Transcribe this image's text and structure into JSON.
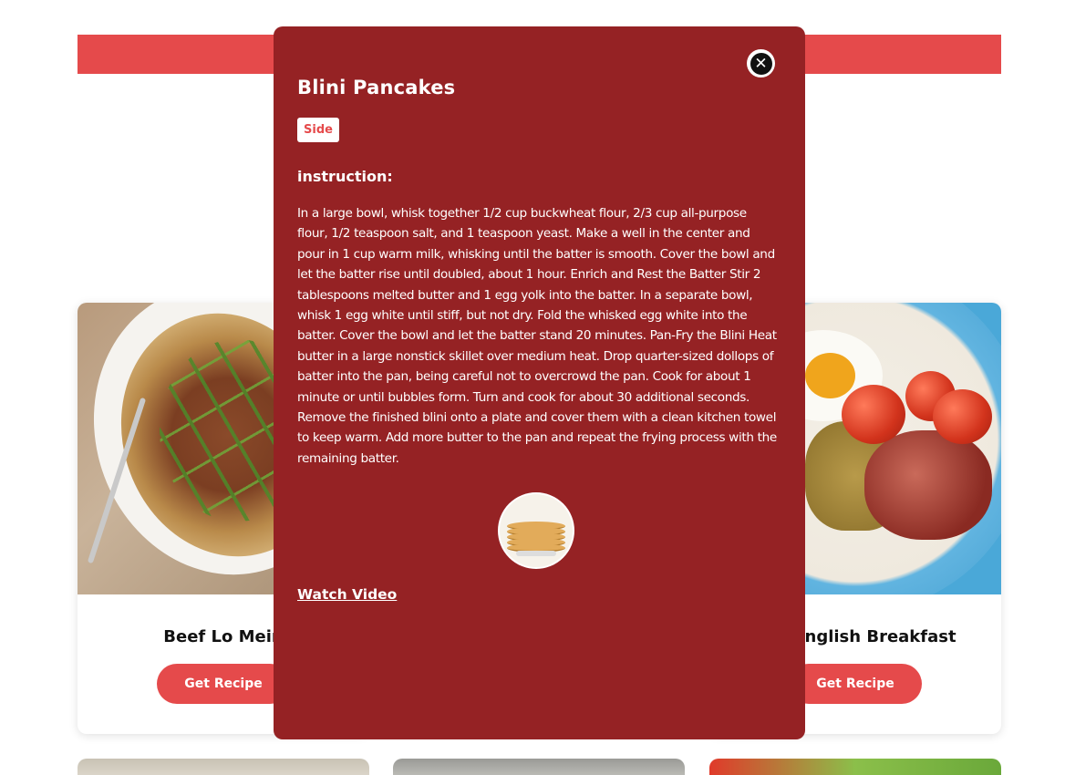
{
  "cards": [
    {
      "title": "Beef Lo Mein",
      "button": "Get Recipe"
    },
    {
      "title": "Full English Breakfast",
      "button": "Get Recipe"
    }
  ],
  "modal": {
    "title": "Blini Pancakes",
    "category": "Side",
    "instruction_label": "instruction:",
    "instructions": "In a large bowl, whisk together 1/2 cup buckwheat flour, 2/3 cup all-purpose flour, 1/2 teaspoon salt, and 1 teaspoon yeast. Make a well in the center and pour in 1 cup warm milk, whisking until the batter is smooth. Cover the bowl and let the batter rise until doubled, about 1 hour. Enrich and Rest the Batter Stir 2 tablespoons melted butter and 1 egg yolk into the batter. In a separate bowl, whisk 1 egg white until stiff, but not dry. Fold the whisked egg white into the batter. Cover the bowl and let the batter stand 20 minutes. Pan-Fry the Blini Heat butter in a large nonstick skillet over medium heat. Drop quarter-sized dollops of batter into the pan, being careful not to overcrowd the pan. Cook for about 1 minute or until bubbles form. Turn and cook for about 30 additional seconds. Remove the finished blini onto a plate and cover them with a clean kitchen towel to keep warm. Add more butter to the pan and repeat the frying process with the remaining batter.",
    "video_link": "Watch Video",
    "close_icon": "close-icon"
  },
  "colors": {
    "accent": "#e54a4b",
    "modal_bg": "#952224"
  }
}
